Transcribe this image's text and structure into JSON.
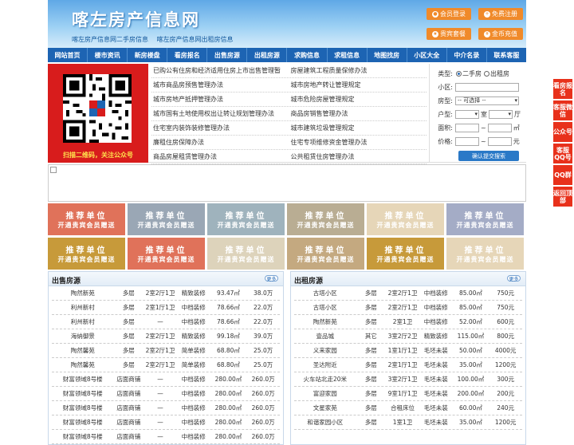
{
  "header": {
    "title": "喀左房产信息网",
    "sub_links": [
      "喀左房产信息网二手房信息",
      "喀左房产信息网出租房信息"
    ],
    "buttons": [
      {
        "label": "会员登录",
        "icon": "user-icon"
      },
      {
        "label": "免费注册",
        "icon": "person-add-icon"
      },
      {
        "label": "贵宾套餐",
        "icon": "vip-icon"
      },
      {
        "label": "金币充值",
        "icon": "coin-icon"
      }
    ]
  },
  "nav": [
    "网站首页",
    "楼市资讯",
    "新房楼盘",
    "看房报名",
    "出售房源",
    "出租房源",
    "求购信息",
    "求租信息",
    "地图找房",
    "小区大全",
    "中介名录",
    "联系客服"
  ],
  "qr": {
    "caption": "扫描二维码，关注公众号"
  },
  "links": [
    [
      "已购公有住房和经济适用住房上市出售管理暂",
      "房屋建筑工程质量保修办法"
    ],
    [
      "城市商品房预售管理办法",
      "城市房地产转让管理规定"
    ],
    [
      "城市房地产抵押管理办法",
      "城市危险房屋管理规定"
    ],
    [
      "城市国有土地使用权出让转让规划管理办法",
      "商品房销售管理办法"
    ],
    [
      "住宅室内装饰装修管理办法",
      "城市建筑垃圾管理规定"
    ],
    [
      "廉租住房保障办法",
      "住宅专项维修资金管理办法"
    ],
    [
      "商品房屋租赁管理办法",
      "公共租赁住房管理办法"
    ]
  ],
  "search": {
    "type_label": "类型:",
    "type_options": [
      "二手房",
      "出租房"
    ],
    "community_label": "小区:",
    "house_type_label": "房型:",
    "house_type_select": "-- 可选择 --",
    "layout_label": "户型:",
    "room_unit": "室",
    "hall_unit": "厅",
    "area_label": "面积:",
    "area_unit": "㎡",
    "price_label": "价格:",
    "price_unit": "元",
    "range_sep": "~",
    "submit": "确认提交搜索"
  },
  "ads": {
    "line1": "推荐单位",
    "line2": "开通贵宾会员赠送",
    "colors": [
      "#e0725a",
      "#9aa7b5",
      "#9fb3bd",
      "#b9ad93",
      "#e6d6b8",
      "#a4acc6",
      "#c79a3a",
      "#e0725a",
      "#ddd3bb",
      "#c4a980",
      "#c79a3a",
      "#e6d6b8"
    ]
  },
  "sale": {
    "title": "出售房源",
    "more": "更多",
    "rows": [
      [
        "陶然新苑",
        "多层",
        "2室2厅1卫",
        "精致装修",
        "93.47㎡",
        "38.0万"
      ],
      [
        "利州新村",
        "多层",
        "2室1厅1卫",
        "中档装修",
        "78.66㎡",
        "22.0万"
      ],
      [
        "利州新村",
        "多层",
        "—",
        "中档装修",
        "78.66㎡",
        "22.0万"
      ],
      [
        "海纳御景",
        "多层",
        "2室2厅1卫",
        "精致装修",
        "99.18㎡",
        "39.0万"
      ],
      [
        "陶然馨苑",
        "多层",
        "2室2厅1卫",
        "简单装修",
        "68.80㎡",
        "25.0万"
      ],
      [
        "陶然馨苑",
        "多层",
        "2室2厅1卫",
        "简单装修",
        "68.80㎡",
        "25.0万"
      ],
      [
        "财富领域8号楼",
        "店面商铺",
        "—",
        "中档装修",
        "280.00㎡",
        "260.0万"
      ],
      [
        "财富领域8号楼",
        "店面商铺",
        "—",
        "中档装修",
        "280.00㎡",
        "260.0万"
      ],
      [
        "财富领域8号楼",
        "店面商铺",
        "—",
        "中档装修",
        "280.00㎡",
        "260.0万"
      ],
      [
        "财富领域8号楼",
        "店面商铺",
        "—",
        "中档装修",
        "280.00㎡",
        "260.0万"
      ],
      [
        "财富领域8号楼",
        "店面商铺",
        "—",
        "中档装修",
        "280.00㎡",
        "260.0万"
      ]
    ]
  },
  "rent": {
    "title": "出租房源",
    "more": "更多",
    "rows": [
      [
        "古塔小区",
        "多层",
        "2室2厅1卫",
        "中档装修",
        "85.00㎡",
        "750元"
      ],
      [
        "古塔小区",
        "多层",
        "2室2厅1卫",
        "中档装修",
        "85.00㎡",
        "750元"
      ],
      [
        "陶然新苑",
        "多层",
        "2室1卫",
        "中档装修",
        "52.00㎡",
        "600元"
      ],
      [
        "壹品城",
        "其它",
        "3室2厅2卫",
        "精致装修",
        "115.00㎡",
        "800元"
      ],
      [
        "义来家园",
        "多层",
        "1室1厅1卫",
        "毛坯未装",
        "50.00㎡",
        "4000元"
      ],
      [
        "圣达附近",
        "多层",
        "2室1厅1卫",
        "毛坯未装",
        "35.00㎡",
        "1200元"
      ],
      [
        "火车站北走20米",
        "多层",
        "3室2厅1卫",
        "毛坯未装",
        "100.00㎡",
        "300元"
      ],
      [
        "富迎家园",
        "多层",
        "9室1厅1卫",
        "毛坯未装",
        "200.00㎡",
        "200元"
      ],
      [
        "文星家苑",
        "多层",
        "合租床位",
        "毛坯未装",
        "60.00㎡",
        "240元"
      ],
      [
        "和谐家园小区",
        "多层",
        "1室1卫",
        "毛坯未装",
        "35.00㎡",
        "1200元"
      ]
    ]
  },
  "side": [
    "看房报名",
    "客服微信",
    "公众号",
    "客服QQ号",
    "QQ群",
    "返回顶部"
  ]
}
